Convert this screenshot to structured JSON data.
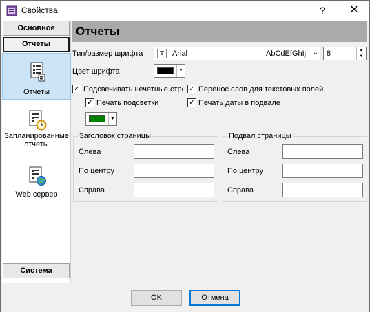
{
  "window": {
    "title": "Свойства",
    "help_label": "?",
    "close_label": "✕"
  },
  "sidebar": {
    "top_header": "Основное",
    "active_header": "Отчеты",
    "bottom_header": "Система",
    "items": [
      {
        "label": "Отчеты",
        "icon": "reports-icon",
        "selected": true
      },
      {
        "label": "Запланированные отчеты",
        "icon": "scheduled-reports-icon",
        "selected": false
      },
      {
        "label": "Web сервер",
        "icon": "web-server-icon",
        "selected": false
      }
    ]
  },
  "page": {
    "title": "Отчеты",
    "font_label": "Тип/размер шрифта",
    "font_name": "Arial",
    "font_sample": "AbCdEfGhIj",
    "font_size": "8",
    "font_color_label": "Цвет шрифта",
    "font_color": "#000000",
    "highlight_color": "#008000",
    "checkboxes": {
      "highlight_odd": "Подсвечивать нечетные стро",
      "word_wrap": "Перенос слов для текстовых полей",
      "print_highlight": "Печать подсветки",
      "print_date": "Печать даты в подвале"
    },
    "header_group": {
      "title": "Заголовок страницы",
      "left": "Слева",
      "center": "По центру",
      "right": "Справа"
    },
    "footer_group": {
      "title": "Подвал страницы",
      "left": "Слева",
      "center": "По центру",
      "right": "Справа"
    }
  },
  "buttons": {
    "ok": "OK",
    "cancel": "Отмена"
  }
}
